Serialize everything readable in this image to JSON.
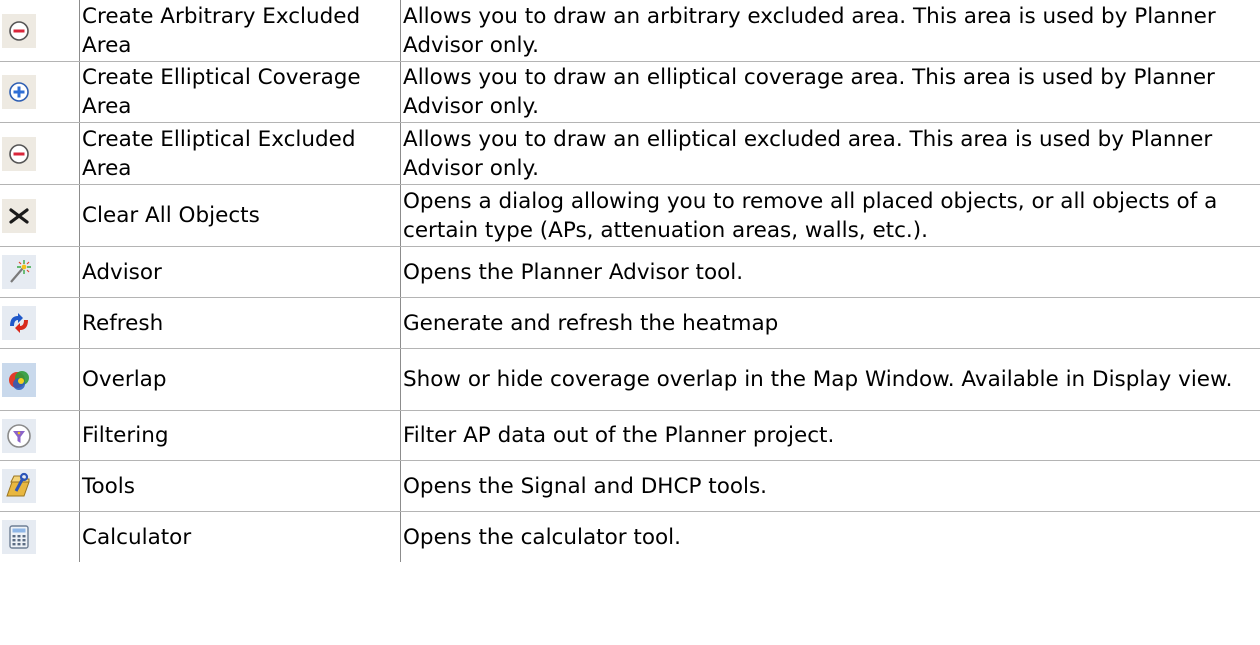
{
  "rows": [
    {
      "icon": "minus-circle-icon",
      "name": "Create Arbitrary Excluded Area",
      "desc": "Allows you to draw an arbitrary excluded area. This area is used by Planner Advisor only."
    },
    {
      "icon": "plus-circle-icon",
      "name": "Create Elliptical Coverage Area",
      "desc": "Allows you to draw an elliptical coverage area. This area is used by Planner Advisor only."
    },
    {
      "icon": "minus-circle-icon",
      "name": "Create Elliptical Excluded Area",
      "desc": "Allows you to draw an elliptical excluded area. This area is used by Planner Advisor only."
    },
    {
      "icon": "clear-x-icon",
      "name": "Clear All Objects",
      "desc": "Opens a dialog allowing you to remove all placed objects, or all objects of a certain type (APs, attenuation areas, walls, etc.)."
    },
    {
      "icon": "magic-wand-icon",
      "name": "Advisor",
      "desc": "Opens the Planner Advisor tool."
    },
    {
      "icon": "refresh-icon",
      "name": "Refresh",
      "desc": "Generate and refresh the heatmap"
    },
    {
      "icon": "overlap-icon",
      "name": "Overlap",
      "desc": "Show or hide coverage overlap in the Map Window. Available in Display view."
    },
    {
      "icon": "filter-icon",
      "name": "Filtering",
      "desc": "Filter AP data out of the Planner project."
    },
    {
      "icon": "tools-icon",
      "name": "Tools",
      "desc": "Opens the Signal and DHCP tools."
    },
    {
      "icon": "calculator-icon",
      "name": "Calculator",
      "desc": "Opens the calculator tool."
    }
  ]
}
